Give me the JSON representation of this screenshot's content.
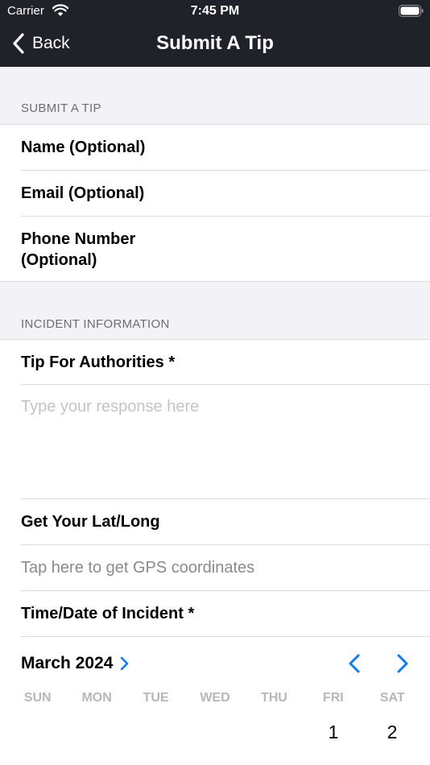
{
  "status_bar": {
    "carrier": "Carrier",
    "time": "7:45 PM"
  },
  "nav": {
    "back_label": "Back",
    "title": "Submit A Tip"
  },
  "submit_section": {
    "header": "SUBMIT A TIP",
    "fields": [
      "Name (Optional)",
      "Email (Optional)",
      "Phone Number\n(Optional)"
    ]
  },
  "incident_section": {
    "header": "INCIDENT INFORMATION",
    "tip_label": "Tip For Authorities *",
    "tip_placeholder": "Type your response here",
    "latlong_label": "Get Your Lat/Long",
    "gps_hint": "Tap here to get GPS coordinates",
    "datetime_label": "Time/Date of Incident *"
  },
  "calendar": {
    "month_label": "March 2024",
    "weekdays": [
      "SUN",
      "MON",
      "TUE",
      "WED",
      "THU",
      "FRI",
      "SAT"
    ],
    "visible_days": [
      "1",
      "2"
    ],
    "accent_color": "#0a7aff"
  },
  "colors": {
    "nav_bar": "#1f2228",
    "background": "#f2f2f7",
    "placeholder": "#c4c4c8"
  }
}
